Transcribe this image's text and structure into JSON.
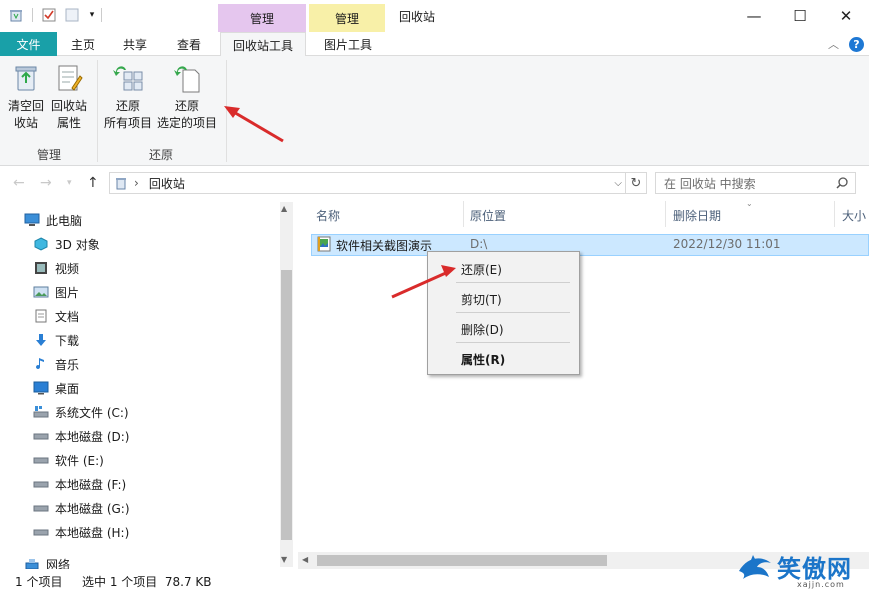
{
  "titlebar": {
    "context_tab_1": "管理",
    "context_tab_2": "管理",
    "window_title": "回收站",
    "minimize": "—",
    "maximize": "☐",
    "close": "✕"
  },
  "tabs": {
    "file": "文件",
    "home": "主页",
    "share": "共享",
    "view": "查看",
    "recycle_tools": "回收站工具",
    "picture_tools": "图片工具"
  },
  "ribbon": {
    "empty_line1": "清空回",
    "empty_line2": "收站",
    "props_line1": "回收站",
    "props_line2": "属性",
    "restore_all_line1": "还原",
    "restore_all_line2": "所有项目",
    "restore_sel_line1": "还原",
    "restore_sel_line2": "选定的项目",
    "group_manage": "管理",
    "group_restore": "还原"
  },
  "address": {
    "path": "回收站",
    "search_placeholder": "在 回收站 中搜索"
  },
  "nav": {
    "items": [
      {
        "label": "此电脑",
        "icon": "pc-icon"
      },
      {
        "label": "3D 对象",
        "icon": "3d-objects-icon"
      },
      {
        "label": "视频",
        "icon": "video-icon"
      },
      {
        "label": "图片",
        "icon": "pictures-icon"
      },
      {
        "label": "文档",
        "icon": "documents-icon"
      },
      {
        "label": "下载",
        "icon": "download-icon"
      },
      {
        "label": "音乐",
        "icon": "music-icon"
      },
      {
        "label": "桌面",
        "icon": "desktop-icon"
      },
      {
        "label": "系统文件 (C:)",
        "icon": "system-drive-icon"
      },
      {
        "label": "本地磁盘 (D:)",
        "icon": "drive-icon"
      },
      {
        "label": "软件 (E:)",
        "icon": "drive-icon"
      },
      {
        "label": "本地磁盘 (F:)",
        "icon": "drive-icon"
      },
      {
        "label": "本地磁盘 (G:)",
        "icon": "drive-icon"
      },
      {
        "label": "本地磁盘 (H:)",
        "icon": "drive-icon"
      },
      {
        "label": "网络",
        "icon": "network-icon"
      }
    ]
  },
  "columns": {
    "name": "名称",
    "original_location": "原位置",
    "date_deleted": "删除日期",
    "size": "大小"
  },
  "file": {
    "name": "软件相关截图演示",
    "original_location": "D:\\",
    "date_deleted": "2022/12/30 11:01"
  },
  "context_menu": {
    "restore": "还原(E)",
    "cut": "剪切(T)",
    "delete": "删除(D)",
    "properties": "属性(R)"
  },
  "status": {
    "item_count": "1 个项目",
    "selected": "选中 1 个项目  78.7 KB"
  },
  "colors": {
    "file_tab": "#19a0a8",
    "manage_tab_1": "#e5c6ee",
    "manage_tab_2": "#f8f0a8",
    "selection": "#cce8ff",
    "annotation_arrow": "#d92b2b"
  },
  "watermark": {
    "text": "笑傲网",
    "url": "xajjn.com"
  }
}
